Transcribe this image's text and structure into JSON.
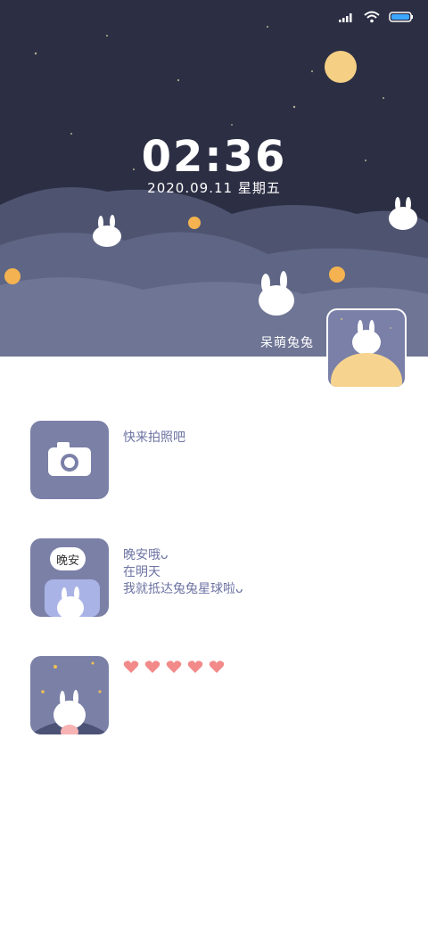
{
  "status": {
    "signal_icon": "signal-icon",
    "wifi_icon": "wifi-icon",
    "battery_icon": "battery-icon"
  },
  "clock": {
    "time": "02:36",
    "date": "2020.09.11 星期五"
  },
  "profile": {
    "name": "呆萌兔兔",
    "avatar_icon": "bunny-on-moon-avatar"
  },
  "items": [
    {
      "icon": "camera-icon",
      "text": "快来拍照吧"
    },
    {
      "icon": "goodnight-bunny-thumbnail",
      "bubble": "晚安",
      "lines": [
        "晚安哦ᴗ",
        "在明天",
        "我就抵达兔兔星球啦ᴗ"
      ]
    },
    {
      "icon": "bunny-stars-thumbnail",
      "hearts": 5
    }
  ],
  "colors": {
    "sky": "#2c2f44",
    "cloud": "#5d6380",
    "text_accent": "#6d73a3",
    "heart": "#f28a8a",
    "thumb_bg": "#7b80a7"
  }
}
